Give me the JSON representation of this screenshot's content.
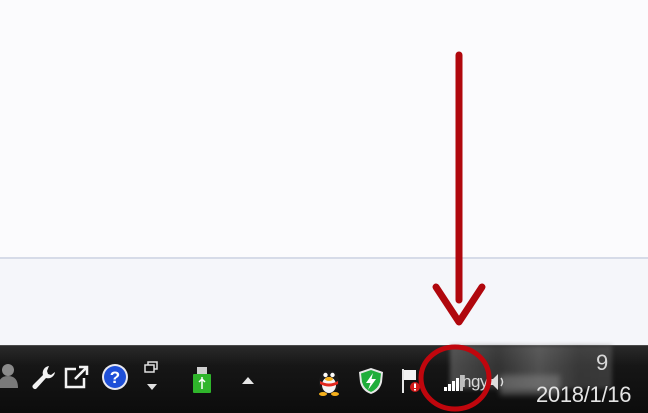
{
  "taskbar": {
    "icons": [
      {
        "name": "user-icon"
      },
      {
        "name": "wrench-icon"
      },
      {
        "name": "external-link-icon"
      },
      {
        "name": "help-icon"
      },
      {
        "name": "restore-window-icon"
      },
      {
        "name": "usb-icon"
      },
      {
        "name": "show-hidden-icon"
      },
      {
        "name": "qq-penguin-icon"
      },
      {
        "name": "shield-icon"
      },
      {
        "name": "action-center-flag-icon"
      },
      {
        "name": "signal-bars-icon"
      },
      {
        "name": "speaker-icon"
      }
    ],
    "network": {
      "ssid": "hgy"
    },
    "clock": {
      "time_fragment": "9",
      "date": "2018/1/16"
    }
  },
  "colors": {
    "annotation_red": "#b0070d",
    "taskbar_bg": "#121212",
    "usb_green": "#2fb52b",
    "shield_green": "#1fae3a",
    "help_blue": "#1e4fd8"
  },
  "annotation": {
    "arrow": "down-arrow",
    "highlight": "circle"
  }
}
